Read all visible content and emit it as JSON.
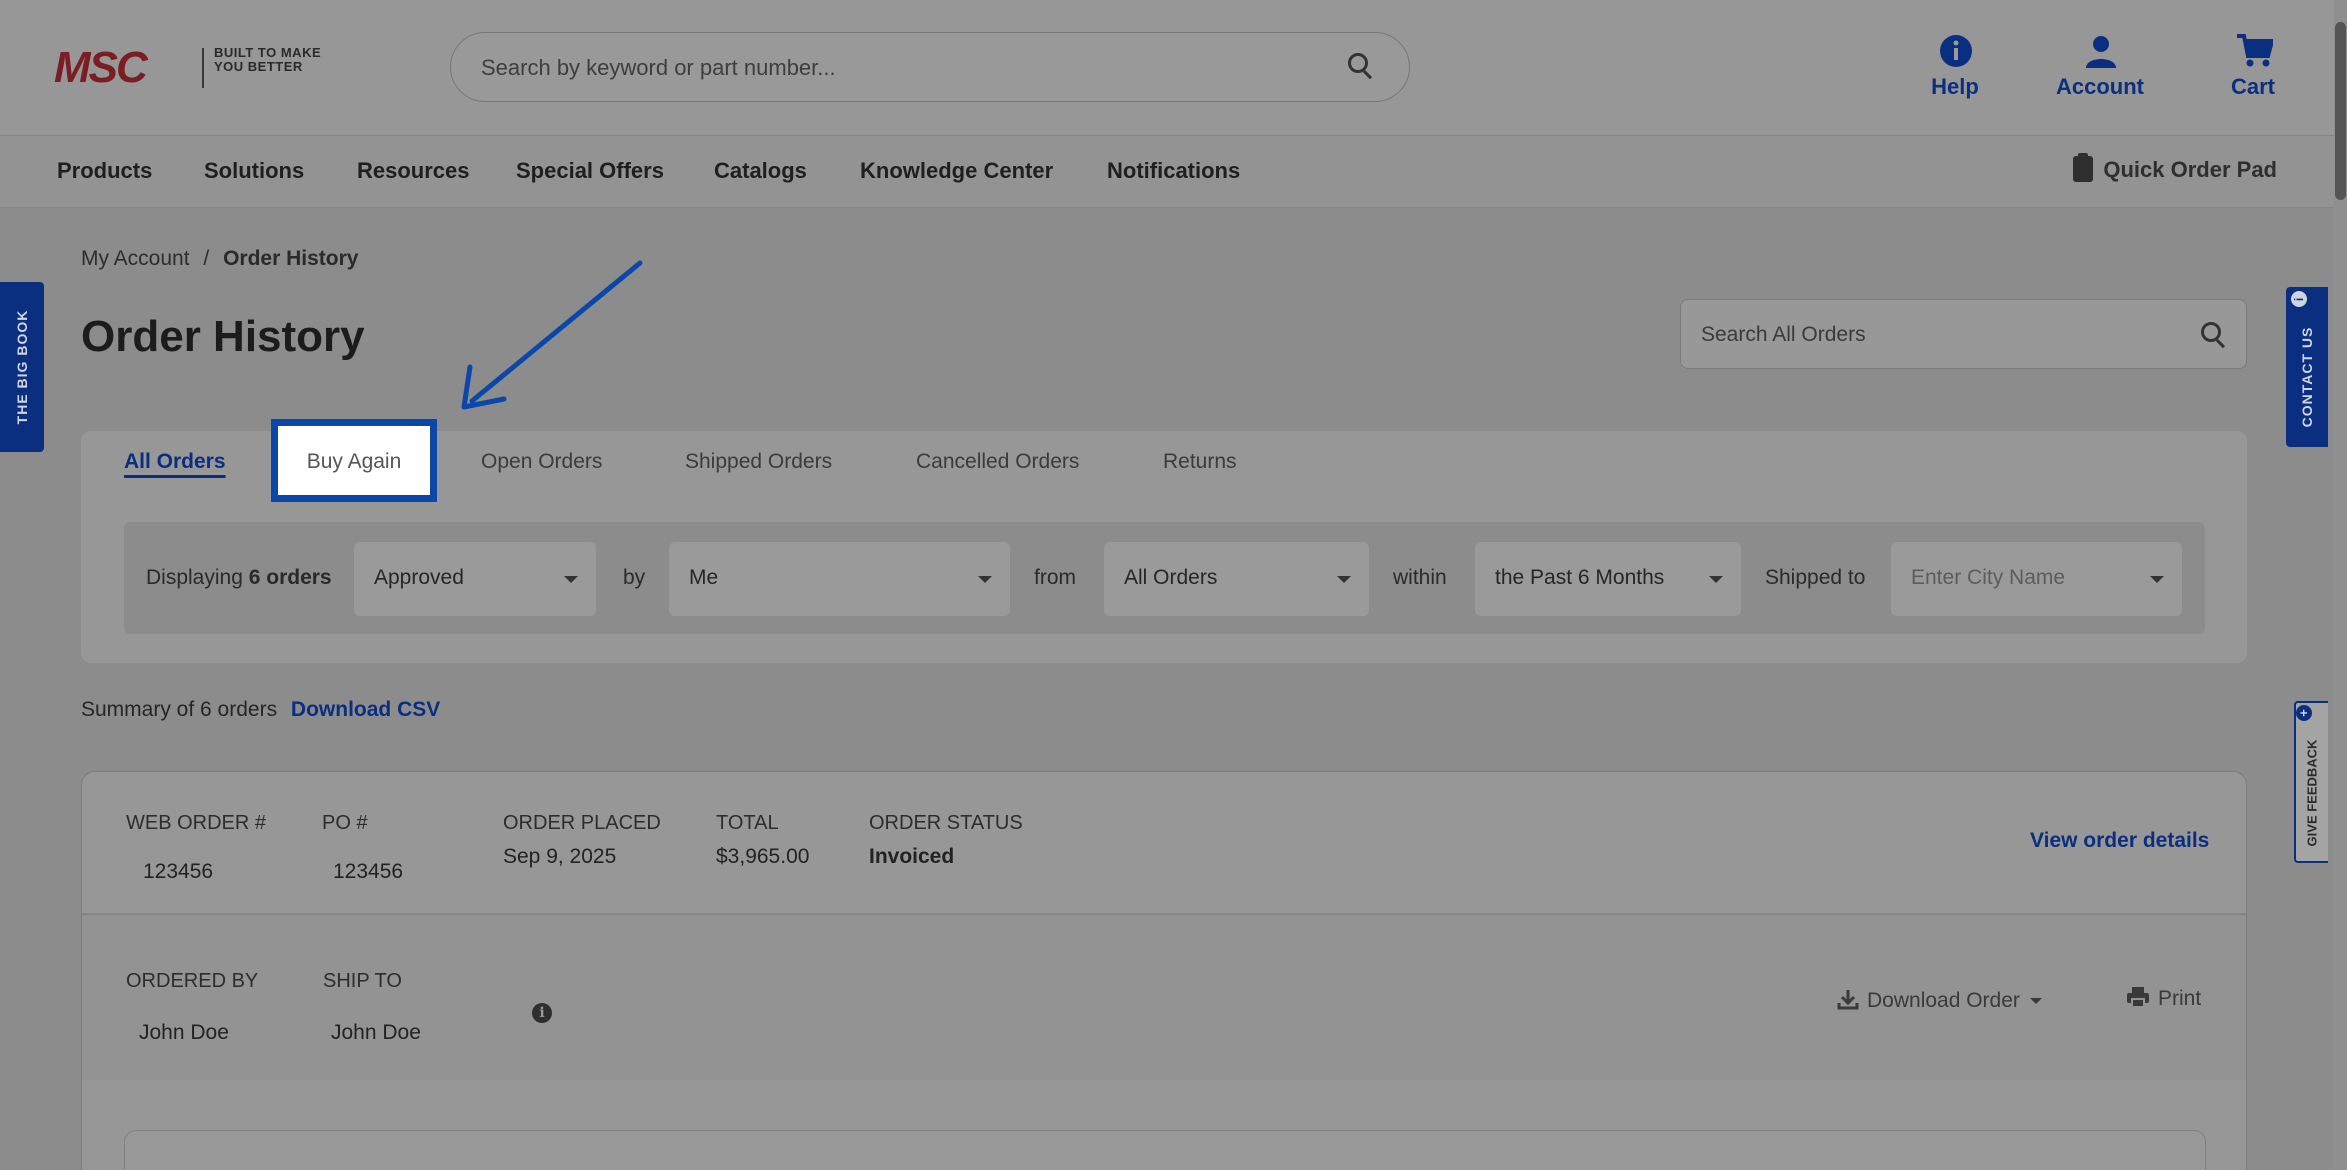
{
  "header": {
    "logo_text": "MSC",
    "logo_tagline": "Built to make you better",
    "search_placeholder": "Search by keyword or part number...",
    "help_label": "Help",
    "account_label": "Account",
    "cart_label": "Cart"
  },
  "nav": {
    "items": [
      "Products",
      "Solutions",
      "Resources",
      "Special Offers",
      "Catalogs",
      "Knowledge Center",
      "Notifications"
    ],
    "quick_order": "Quick Order Pad"
  },
  "side_tabs": {
    "big_book": "THE BIG BOOK",
    "contact_us": "CONTACT US",
    "give_feedback": "GIVE FEEDBACK"
  },
  "breadcrumb": {
    "parent": "My Account",
    "separator": "/",
    "current": "Order History"
  },
  "page_title": "Order History",
  "order_search_placeholder": "Search All Orders",
  "tabs": [
    "All Orders",
    "Buy Again",
    "Open Orders",
    "Shipped Orders",
    "Cancelled Orders",
    "Returns"
  ],
  "filters": {
    "displaying_prefix": "Displaying",
    "displaying_count": "6 orders",
    "status": "Approved",
    "by_label": "by",
    "by_value": "Me",
    "from_label": "from",
    "from_value": "All Orders",
    "within_label": "within",
    "within_value": "the Past 6 Months",
    "shipped_to_label": "Shipped to",
    "city_placeholder": "Enter City Name"
  },
  "summary": {
    "text": "Summary of 6 orders",
    "download_csv": "Download CSV"
  },
  "order": {
    "web_order_label": "WEB ORDER #",
    "web_order_value": "123456",
    "po_label": "PO #",
    "po_value": "123456",
    "placed_label": "ORDER PLACED",
    "placed_value": "Sep 9, 2025",
    "total_label": "TOTAL",
    "total_value": "$3,965.00",
    "status_label": "ORDER STATUS",
    "status_value": "Invoiced",
    "view_details": "View order details",
    "ordered_by_label": "ORDERED BY",
    "ordered_by_value": "John Doe",
    "ship_to_label": "SHIP TO",
    "ship_to_value": "John Doe",
    "download_order": "Download Order",
    "print": "Print"
  },
  "colors": {
    "brand_blue": "#0b2f80",
    "highlight_border": "#0b47a8",
    "logo_red": "#7a1e23",
    "overlay_gray": "#8c8c8c"
  }
}
